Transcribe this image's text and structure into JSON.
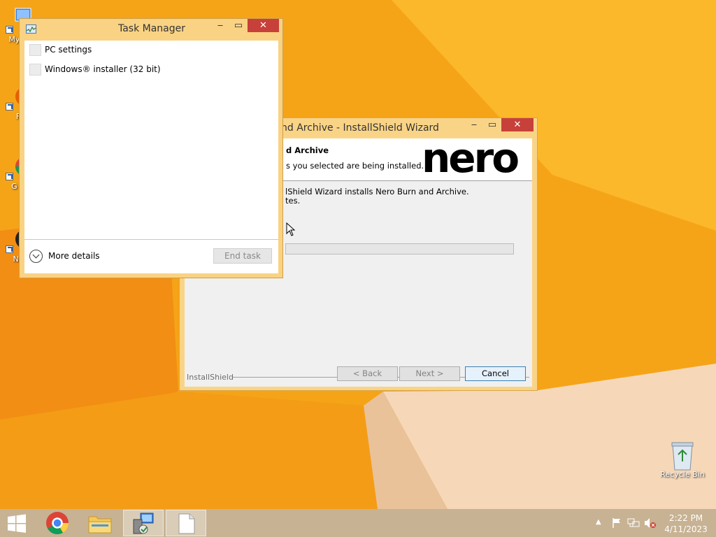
{
  "desktop": {
    "icons": [
      {
        "label": "My C",
        "name": "my-computer"
      },
      {
        "label": "F",
        "name": "firefox"
      },
      {
        "label": "G C",
        "name": "google-chrome"
      },
      {
        "label": "Ne",
        "name": "nero"
      }
    ],
    "recycle_bin": {
      "label": "Recycle Bin"
    }
  },
  "installer": {
    "title": "nd Archive - InstallShield Wizard",
    "header_title": "d Archive",
    "header_subtitle": "s you selected are being installed.",
    "logo": "nero",
    "status_line1": "lShield Wizard installs Nero Burn and Archive.",
    "status_line2": "tes.",
    "progress": 0,
    "brand": "InstallShield",
    "buttons": {
      "back": "< Back",
      "next": "Next >",
      "cancel": "Cancel"
    }
  },
  "task_manager": {
    "title": "Task Manager",
    "processes": [
      {
        "name": "PC settings"
      },
      {
        "name": "Windows® installer (32 bit)"
      }
    ],
    "more_details": "More details",
    "end_task": "End task"
  },
  "taskbar": {
    "apps": [
      "start",
      "chrome",
      "file-explorer",
      "installer",
      "document"
    ],
    "clock": {
      "time": "2:22 PM",
      "date": "4/11/2023"
    }
  },
  "colors": {
    "wallpaper": "#f7a91a",
    "taskbar": "#c7b293",
    "window_frame": "#fad486",
    "close_button": "#c7403a"
  }
}
